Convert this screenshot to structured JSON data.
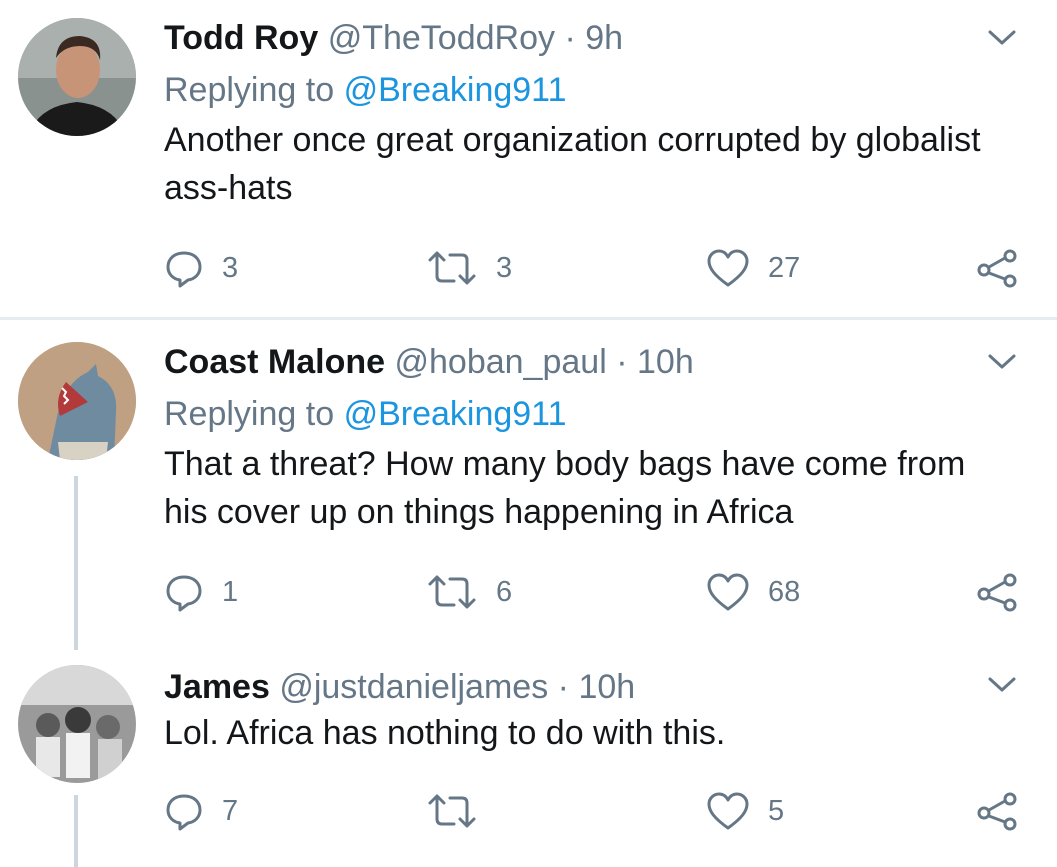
{
  "tweets": [
    {
      "name": "Todd Roy",
      "handle": "@TheToddRoy",
      "sep": "·",
      "time": "9h",
      "replying_prefix": "Replying to",
      "replying_to": "@Breaking911",
      "text": "Another once great organization corrupted by globalist ass-hats",
      "replies": "3",
      "retweets": "3",
      "likes": "27"
    },
    {
      "name": "Coast Malone",
      "handle": "@hoban_paul",
      "sep": "·",
      "time": "10h",
      "replying_prefix": "Replying to",
      "replying_to": "@Breaking911",
      "text": "That a threat? How many body bags have come from his cover up on things happening in Africa",
      "replies": "1",
      "retweets": "6",
      "likes": "68"
    },
    {
      "name": "James",
      "handle": "@justdanieljames",
      "sep": "·",
      "time": "10h",
      "text": "Lol. Africa has nothing to do with this.",
      "replies": "7",
      "retweets": "",
      "likes": "5"
    }
  ],
  "colors": {
    "text": "#14171a",
    "muted": "#657786",
    "link": "#1b95e0",
    "divider": "#e6ecf0",
    "thread_line": "#ccd6dd"
  },
  "icons": [
    "chevron-down-icon",
    "reply-icon",
    "retweet-icon",
    "like-icon",
    "share-icon"
  ]
}
